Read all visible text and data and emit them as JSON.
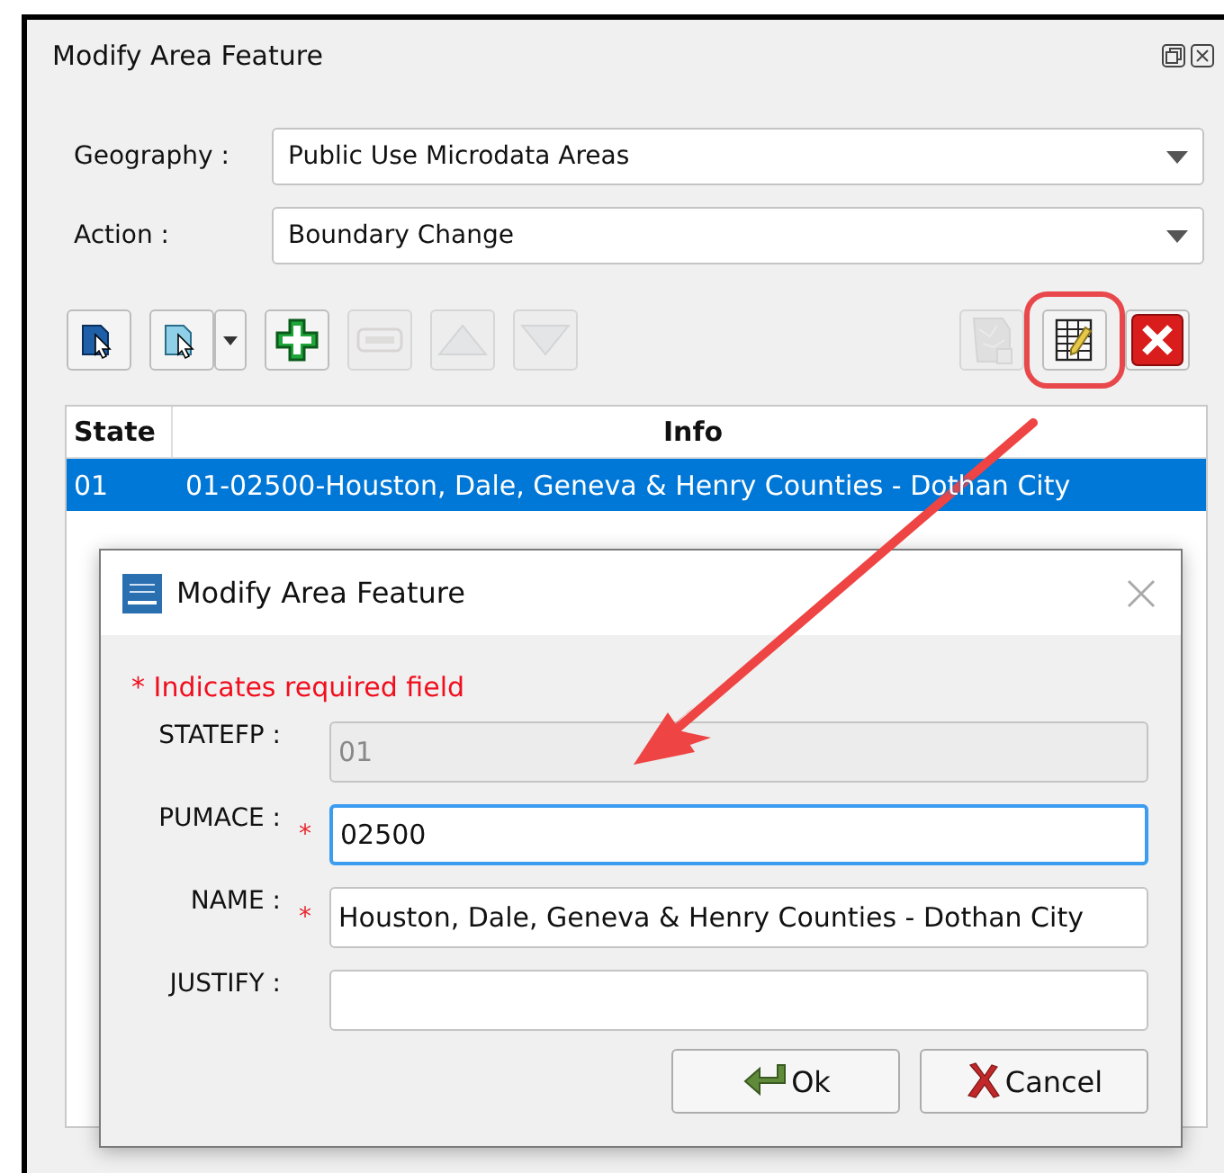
{
  "window": {
    "title": "Modify Area Feature"
  },
  "selectors": [
    {
      "label": "Geography :",
      "value": "Public Use Microdata Areas"
    },
    {
      "label": "Action :",
      "value": "Boundary Change"
    }
  ],
  "toolbar": [
    {
      "kind": "select-filled",
      "disabled": false,
      "highlighted": false
    },
    {
      "kind": "select-menu",
      "disabled": false,
      "highlighted": false
    },
    {
      "kind": "add",
      "disabled": false,
      "highlighted": false
    },
    {
      "kind": "remove",
      "disabled": true,
      "highlighted": false
    },
    {
      "kind": "up",
      "disabled": true,
      "highlighted": false
    },
    {
      "kind": "down",
      "disabled": true,
      "highlighted": false
    },
    {
      "kind": "map",
      "disabled": true,
      "highlighted": false
    },
    {
      "kind": "edit",
      "disabled": false,
      "highlighted": true
    },
    {
      "kind": "delete",
      "disabled": false,
      "highlighted": false
    }
  ],
  "table": {
    "columns": [
      "State",
      "Info"
    ],
    "rows": [
      {
        "cells": [
          "01",
          "01-02500-Houston, Dale, Geneva & Henry Counties - Dothan City"
        ],
        "selected": true
      }
    ]
  },
  "dialog": {
    "title": "Modify Area Feature",
    "required_note": "* Indicates required field",
    "fields": [
      {
        "label": "STATEFP :",
        "value": "01",
        "required": false,
        "disabled": true,
        "focused": false
      },
      {
        "label": "PUMACE :",
        "value": "02500",
        "required": true,
        "disabled": false,
        "focused": true
      },
      {
        "label": "NAME :",
        "value": "Houston, Dale, Geneva & Henry Counties - Dothan City",
        "required": true,
        "disabled": false,
        "focused": false
      },
      {
        "label": "JUSTIFY :",
        "required": false,
        "disabled": false,
        "focused": false
      }
    ],
    "required_mark": "*",
    "buttons": [
      {
        "kind": "ok",
        "label": "Ok"
      },
      {
        "kind": "cancel",
        "label": "Cancel"
      }
    ]
  }
}
